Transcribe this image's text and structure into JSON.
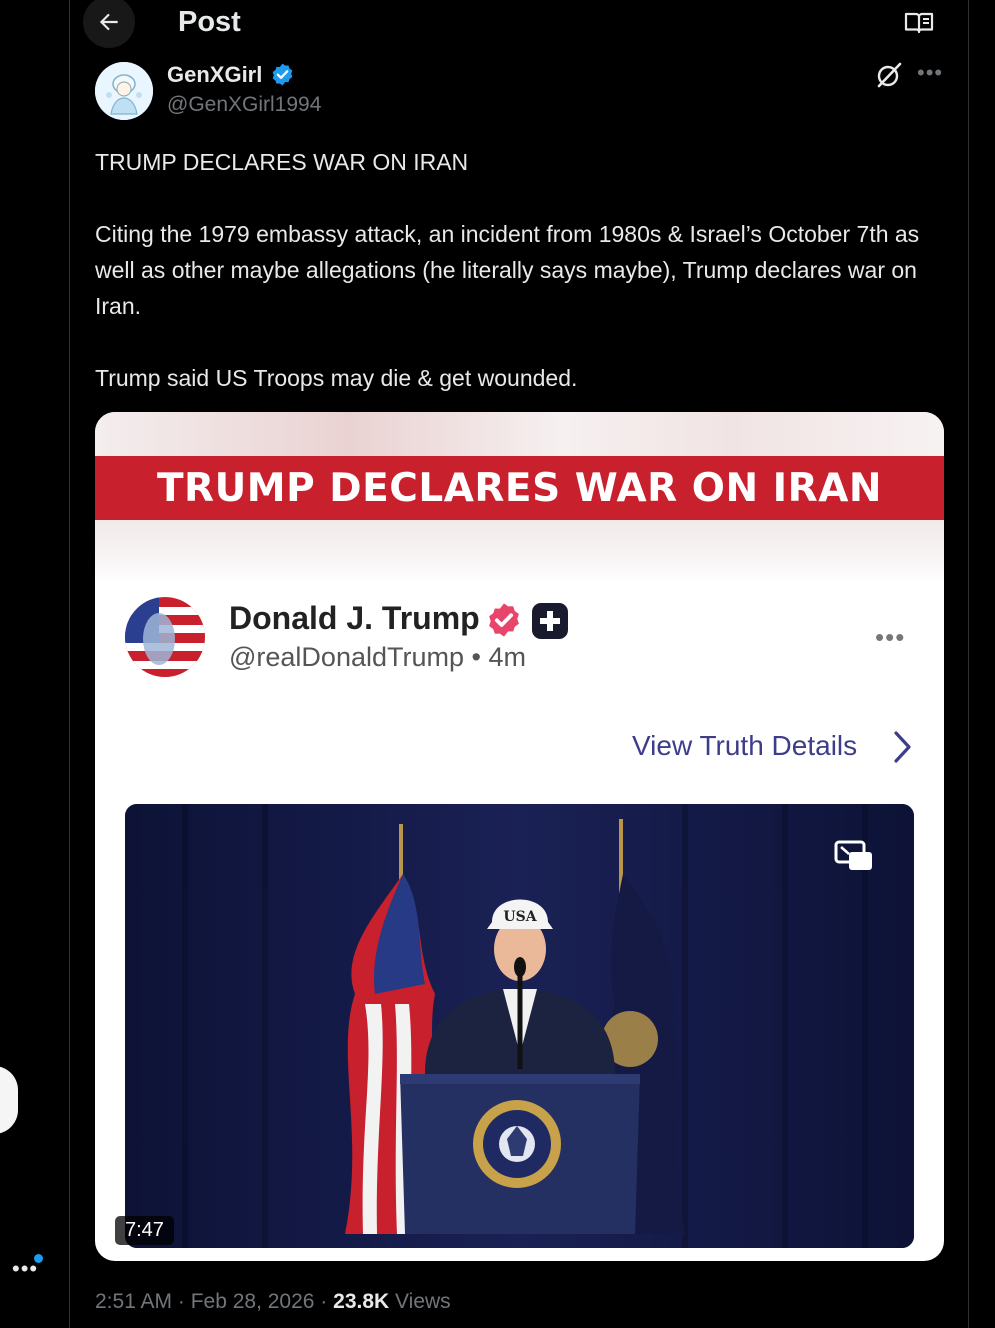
{
  "header": {
    "title": "Post"
  },
  "author": {
    "name": "GenXGirl",
    "handle": "@GenXGirl1994"
  },
  "post": {
    "headline": "TRUMP DECLARES WAR ON IRAN",
    "paragraph1": "Citing the 1979 embassy attack, an incident from 1980s & Israel’s October 7th as well as other maybe allegations (he literally says maybe), Trump declares war on Iran.",
    "paragraph2": "Trump said US Troops may die & get wounded."
  },
  "media": {
    "banner": "TRUMP DECLARES WAR ON IRAN",
    "truth_author": "Donald J. Trump",
    "truth_handle": "@realDonaldTrump • 4m",
    "view_details": "View Truth Details",
    "video_duration": "7:47",
    "cap_text": "USA"
  },
  "meta": {
    "timestamp": "2:51 AM · Feb 28, 2026 · ",
    "views_count": "23.8K",
    "views_label": " Views"
  },
  "colors": {
    "accent": "#1d9bf0",
    "banner_red": "#c8202d",
    "truth_link": "#3e3d8a",
    "verified_pink": "#e8456b"
  },
  "icons": [
    "back-arrow-icon",
    "reader-mode-icon",
    "verified-badge-icon",
    "grok-icon",
    "more-icon",
    "picture-in-picture-icon",
    "chevron-right-icon"
  ]
}
